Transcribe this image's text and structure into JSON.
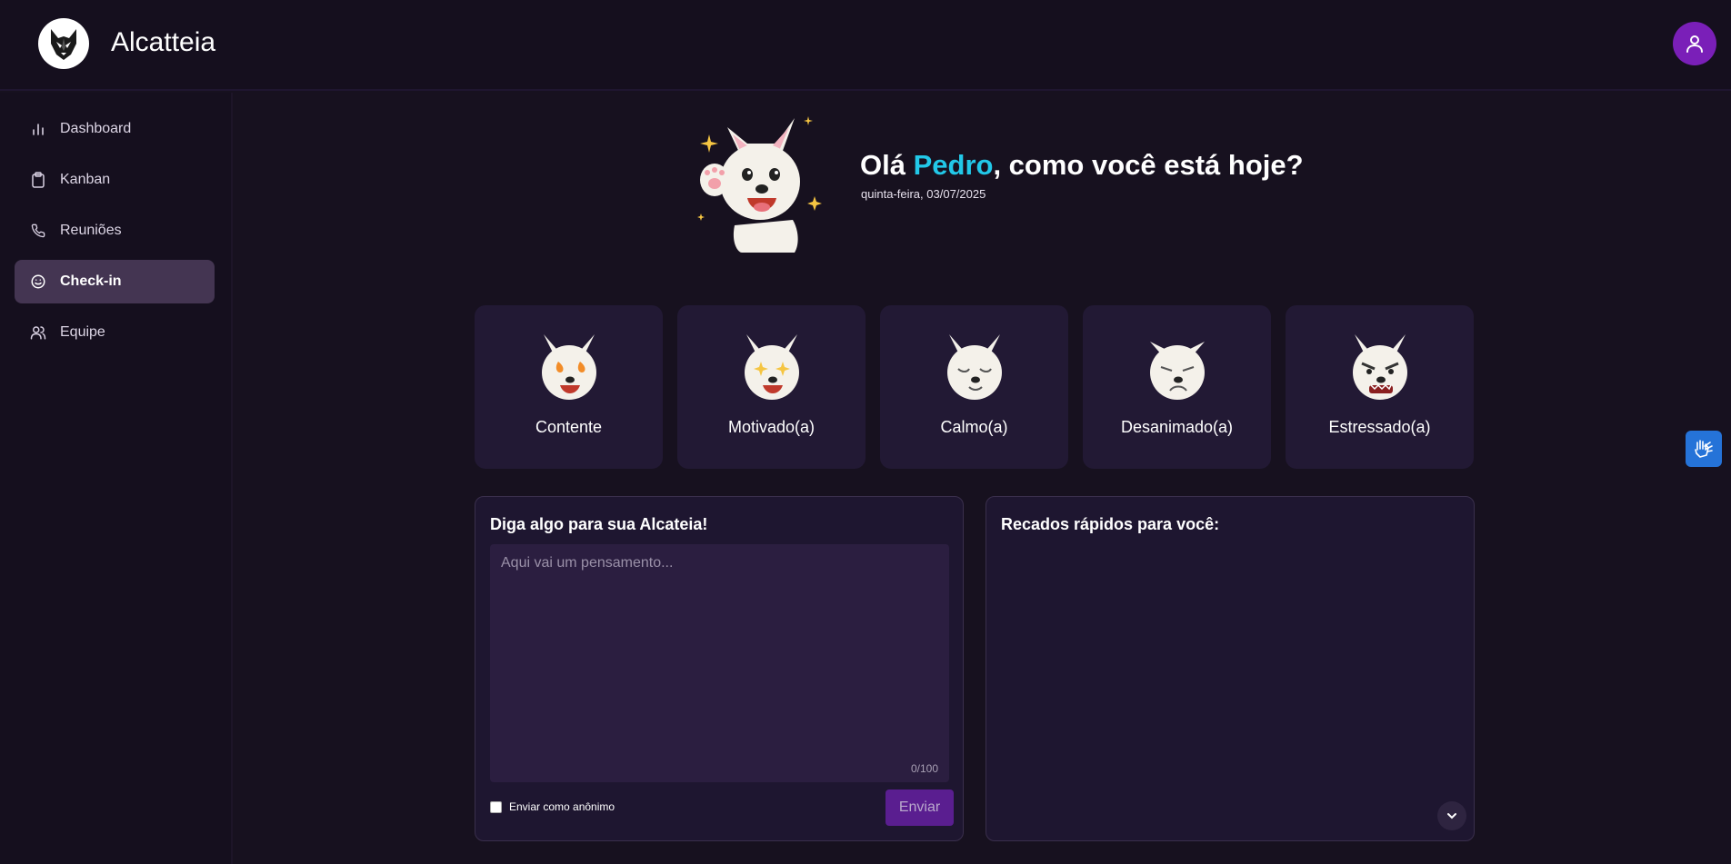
{
  "header": {
    "app_title": "Alcatteia",
    "logo_icon": "wolf-logo-icon",
    "profile_icon": "user-icon",
    "profile_color": "#7a1fb8"
  },
  "sidebar": {
    "items": [
      {
        "label": "Dashboard",
        "icon": "bar-chart-icon",
        "active": false
      },
      {
        "label": "Kanban",
        "icon": "clipboard-icon",
        "active": false
      },
      {
        "label": "Reuniões",
        "icon": "phone-icon",
        "active": false
      },
      {
        "label": "Check-in",
        "icon": "smile-icon",
        "active": true
      },
      {
        "label": "Equipe",
        "icon": "users-icon",
        "active": false
      }
    ]
  },
  "greeting": {
    "prefix": "Olá ",
    "name": "Pedro",
    "suffix": ", como você está hoje?",
    "date": "quinta-feira, 03/07/2025",
    "name_color": "#22c8e8"
  },
  "moods": [
    {
      "label": "Contente",
      "icon": "wolf-fire-eyes-icon"
    },
    {
      "label": "Motivado(a)",
      "icon": "wolf-star-eyes-icon"
    },
    {
      "label": "Calmo(a)",
      "icon": "wolf-calm-icon"
    },
    {
      "label": "Desanimado(a)",
      "icon": "wolf-sad-icon"
    },
    {
      "label": "Estressado(a)",
      "icon": "wolf-angry-icon"
    }
  ],
  "message_panel": {
    "title": "Diga algo para sua Alcateia!",
    "placeholder": "Aqui vai um pensamento...",
    "value": "",
    "counter": "0/100",
    "anonymous_label": "Enviar como anônimo",
    "anonymous_checked": false,
    "send_label": "Enviar"
  },
  "notes_panel": {
    "title": "Recados rápidos para você:"
  },
  "accessibility": {
    "icon": "sign-language-hands-icon",
    "color": "#2573d8"
  }
}
